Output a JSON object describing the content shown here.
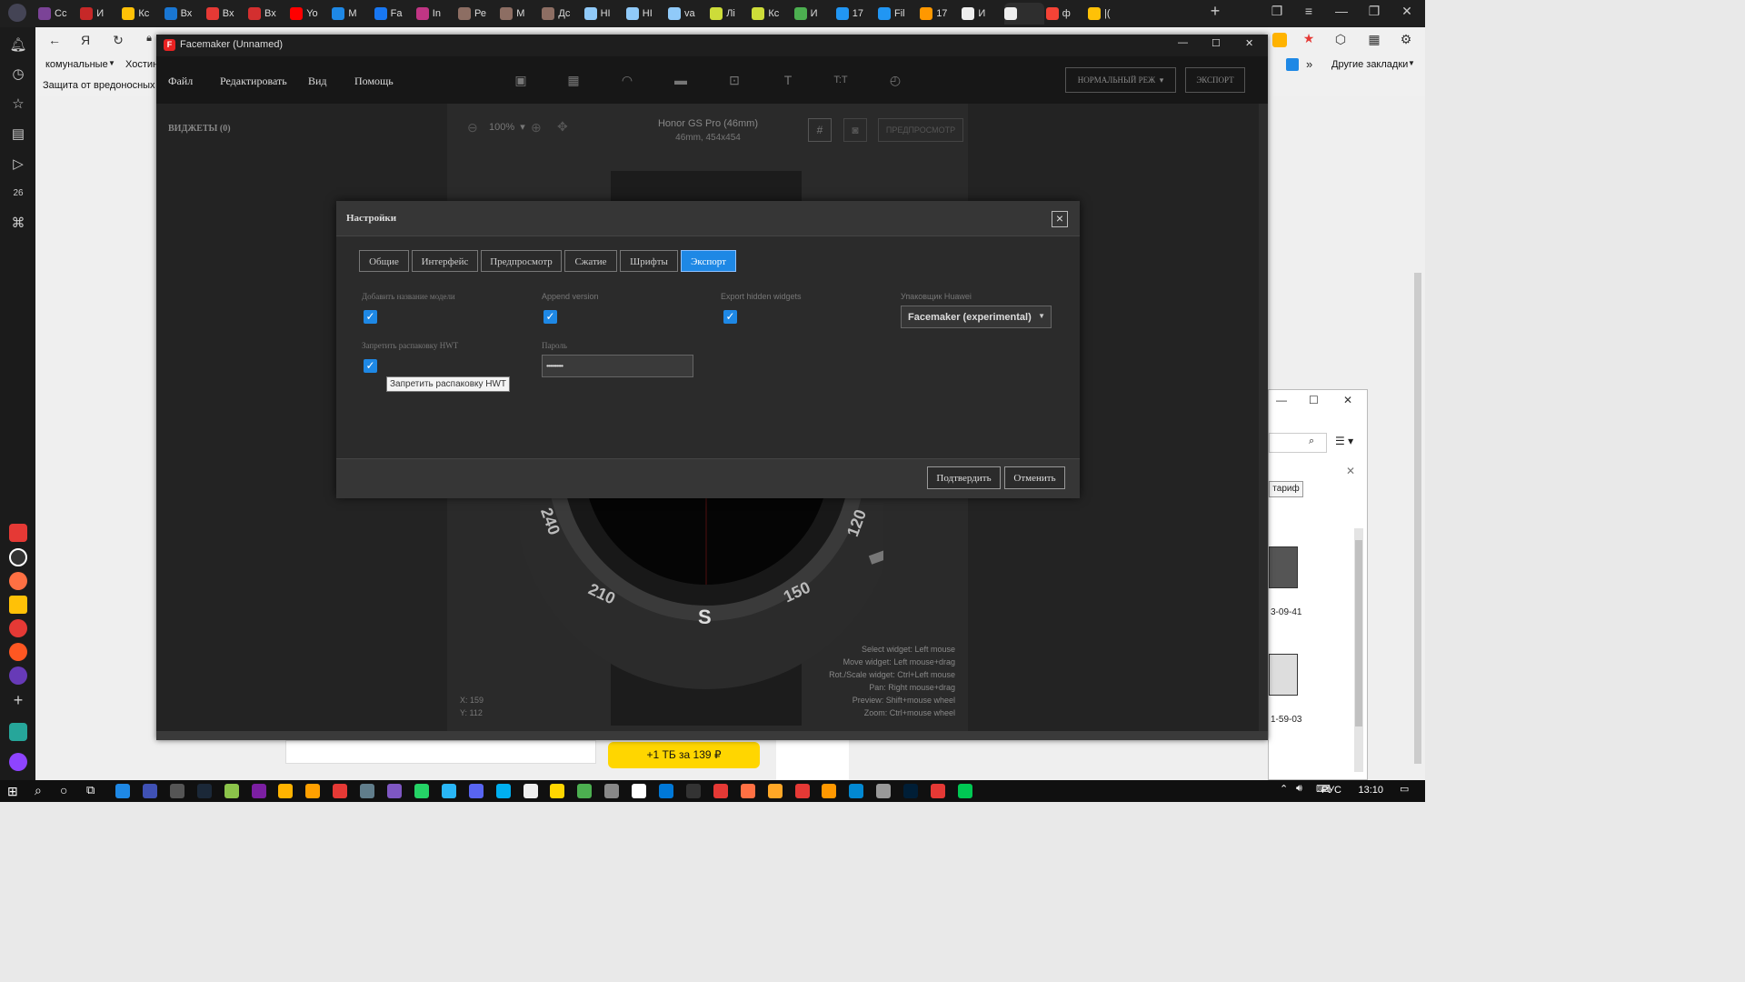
{
  "browser": {
    "tabs": [
      {
        "label": "Сс",
        "color": "#7b4397"
      },
      {
        "label": "И",
        "color": "#c62828"
      },
      {
        "label": "Кс",
        "color": "#ffc107"
      },
      {
        "label": "Вх",
        "color": "#1976d2"
      },
      {
        "label": "Вх",
        "color": "#e53935"
      },
      {
        "label": "Вх",
        "color": "#d32f2f"
      },
      {
        "label": "Yo",
        "color": "#ff0000"
      },
      {
        "label": "М",
        "color": "#1e88e5"
      },
      {
        "label": "Fa",
        "color": "#1877f2"
      },
      {
        "label": "In",
        "color": "#c13584"
      },
      {
        "label": "Ре",
        "color": "#8d6e63"
      },
      {
        "label": "М",
        "color": "#8d6e63"
      },
      {
        "label": "Дс",
        "color": "#8d6e63"
      },
      {
        "label": "HI",
        "color": "#90caf9"
      },
      {
        "label": "HI",
        "color": "#90caf9"
      },
      {
        "label": "va",
        "color": "#90caf9"
      },
      {
        "label": "Лі",
        "color": "#cddc39"
      },
      {
        "label": "Кс",
        "color": "#cddc39"
      },
      {
        "label": "И",
        "color": "#4caf50"
      },
      {
        "label": "17",
        "color": "#2196f3"
      },
      {
        "label": "Fil",
        "color": "#2196f3"
      },
      {
        "label": "17",
        "color": "#ff9800"
      },
      {
        "label": "И",
        "color": "#eeeeee"
      },
      {
        "label": "",
        "color": "#eeeeee"
      },
      {
        "label": "ф",
        "color": "#f44336"
      },
      {
        "label": "|(",
        "color": "#ffc107"
      }
    ],
    "bookmarks": {
      "item1": "комунальные",
      "item2": "Хостин",
      "other": "Другие закладки"
    },
    "infobar_text": "Защита от вредоносных п"
  },
  "app": {
    "title": "Facemaker (Unnamed)",
    "logo": "F",
    "menu": [
      "Файл",
      "Редактировать",
      "Вид",
      "Помощь"
    ],
    "mode_button": "НОРМАЛЬНЫЙ РЕЖ",
    "export_button": "ЭКСПОРТ",
    "widgets_label": "ВИДЖЕТЫ",
    "widgets_count": "(0)",
    "zoom": "100%",
    "model_name": "Honor GS Pro (46mm)",
    "model_size": "46mm, 454x454",
    "preview_button": "ПРЕДПРОСМОТР",
    "coord_x": "X: 159",
    "coord_y": "Y: 112",
    "help_lines": [
      "Select widget: Left mouse",
      "Move widget: Left mouse+drag",
      "Rot./Scale widget: Ctrl+Left mouse",
      "Pan: Right mouse+drag",
      "Preview: Shift+mouse wheel",
      "Zoom: Ctrl+mouse wheel"
    ],
    "bezel_numbers": [
      "240",
      "210",
      "S",
      "150",
      "120"
    ]
  },
  "dialog": {
    "title": "Настройки",
    "tabs": [
      "Общие",
      "Интерфейс",
      "Предпросмотр",
      "Сжатие",
      "Шрифты",
      "Экспорт"
    ],
    "active_tab": "Экспорт",
    "fields": {
      "add_model_name": {
        "label": "Добавить название модели",
        "checked": true
      },
      "append_version": {
        "label": "Append version",
        "checked": true
      },
      "export_hidden": {
        "label": "Export hidden widgets",
        "checked": true
      },
      "packer": {
        "label": "Упаковщик Huawei",
        "value": "Facemaker (experimental)"
      },
      "forbid_unpack": {
        "label": "Запретить распаковку HWT",
        "checked": true
      },
      "password": {
        "label": "Пароль",
        "value": "••••••••••"
      }
    },
    "tooltip": "Запретить распаковку HWT",
    "confirm": "Подтвердить",
    "cancel": "Отменить"
  },
  "explorer": {
    "file1": "3-09-41",
    "file2": "1-59-03",
    "tarif_button": "тариф"
  },
  "promo": {
    "yellow_button": "+1 ТБ за 139 ₽"
  },
  "taskbar": {
    "lang": "РУС",
    "time": "13:10"
  }
}
